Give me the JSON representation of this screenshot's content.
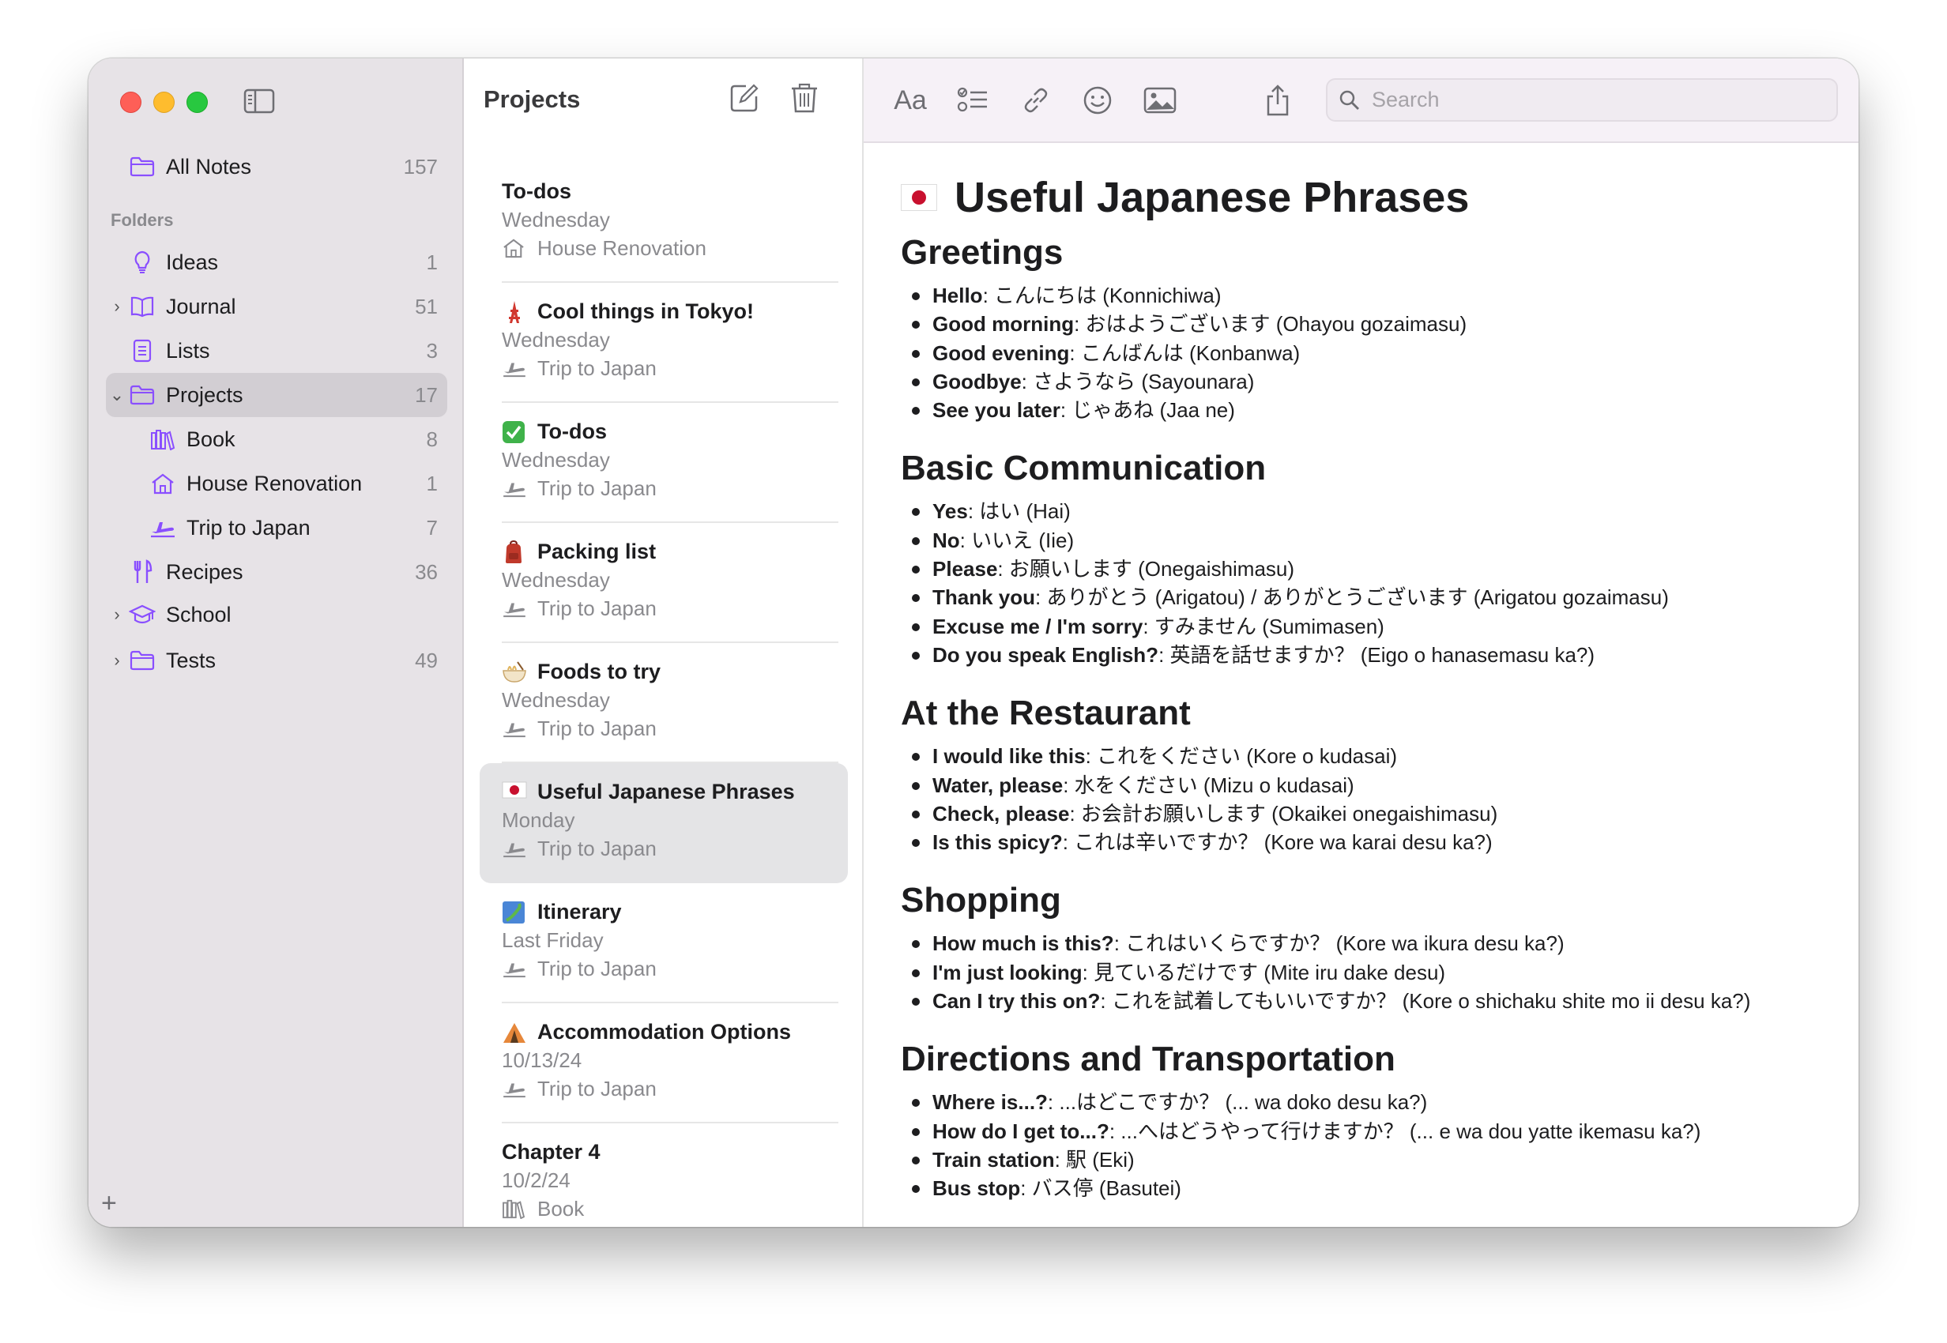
{
  "colors": {
    "accent": "#8a4fff",
    "sidebar_bg": "#e7e3e7",
    "toolbar_bg": "#f6f1f7",
    "traffic_close": "#fe5f57",
    "traffic_min": "#febc2e",
    "traffic_max": "#28c840"
  },
  "sidebar": {
    "all_notes": {
      "label": "All Notes",
      "count": "157",
      "icon": "folder-icon"
    },
    "section_label": "Folders",
    "folders": [
      {
        "label": "Ideas",
        "count": "1",
        "icon": "lightbulb-icon"
      },
      {
        "label": "Journal",
        "count": "51",
        "icon": "book-icon",
        "collapsed": true
      },
      {
        "label": "Lists",
        "count": "3",
        "icon": "list-icon"
      },
      {
        "label": "Projects",
        "count": "17",
        "icon": "folder-icon",
        "expanded": true,
        "selected": true
      },
      {
        "label": "Book",
        "count": "8",
        "icon": "books-icon"
      },
      {
        "label": "House Renovation",
        "count": "1",
        "icon": "house-icon"
      },
      {
        "label": "Trip to Japan",
        "count": "7",
        "icon": "airplane-icon"
      },
      {
        "label": "Recipes",
        "count": "36",
        "icon": "fork-knife-icon"
      },
      {
        "label": "School",
        "count": "",
        "icon": "graduation-cap-icon",
        "collapsed": true
      },
      {
        "label": "Tests",
        "count": "49",
        "icon": "folder-icon",
        "collapsed": true
      }
    ],
    "add_label": "+"
  },
  "note_list": {
    "title": "Projects",
    "notes": [
      {
        "title": "To-dos",
        "date": "Wednesday",
        "folder": "House Renovation",
        "emoji": "",
        "folder_icon": "house-icon"
      },
      {
        "title": "Cool things in Tokyo!",
        "date": "Wednesday",
        "folder": "Trip to Japan",
        "emoji": "tokyo-tower",
        "folder_icon": "airplane-icon"
      },
      {
        "title": "To-dos",
        "date": "Wednesday",
        "folder": "Trip to Japan",
        "emoji": "check-mark-button",
        "folder_icon": "airplane-icon"
      },
      {
        "title": "Packing list",
        "date": "Wednesday",
        "folder": "Trip to Japan",
        "emoji": "backpack",
        "folder_icon": "airplane-icon"
      },
      {
        "title": "Foods to try",
        "date": "Wednesday",
        "folder": "Trip to Japan",
        "emoji": "ramen-bowl",
        "folder_icon": "airplane-icon"
      },
      {
        "title": "Useful Japanese Phrases",
        "date": "Monday",
        "folder": "Trip to Japan",
        "emoji": "japan-flag",
        "folder_icon": "airplane-icon",
        "selected": true
      },
      {
        "title": "Itinerary",
        "date": "Last Friday",
        "folder": "Trip to Japan",
        "emoji": "japan-map",
        "folder_icon": "airplane-icon"
      },
      {
        "title": "Accommodation Options",
        "date": "10/13/24",
        "folder": "Trip to Japan",
        "emoji": "tent",
        "folder_icon": "airplane-icon"
      },
      {
        "title": "Chapter 4",
        "date": "10/2/24",
        "folder": "Book",
        "emoji": "",
        "folder_icon": "books-icon"
      }
    ]
  },
  "toolbar": {
    "format_label": "Aa",
    "search_placeholder": "Search"
  },
  "document": {
    "title": "Useful Japanese Phrases",
    "sections": [
      {
        "heading": "Greetings",
        "items": [
          {
            "term": "Hello",
            "text": ": こんにちは (Konnichiwa)"
          },
          {
            "term": "Good morning",
            "text": ": おはようございます (Ohayou gozaimasu)"
          },
          {
            "term": "Good evening",
            "text": ": こんばんは (Konbanwa)"
          },
          {
            "term": "Goodbye",
            "text": ": さようなら (Sayounara)"
          },
          {
            "term": "See you later",
            "text": ": じゃあね (Jaa ne)"
          }
        ]
      },
      {
        "heading": "Basic Communication",
        "items": [
          {
            "term": "Yes",
            "text": ": はい (Hai)"
          },
          {
            "term": "No",
            "text": ": いいえ (Iie)"
          },
          {
            "term": "Please",
            "text": ": お願いします (Onegaishimasu)"
          },
          {
            "term": "Thank you",
            "text": ": ありがとう (Arigatou) / ありがとうございます (Arigatou gozaimasu)"
          },
          {
            "term": "Excuse me / I'm sorry",
            "text": ": すみません (Sumimasen)"
          },
          {
            "term": "Do you speak English?",
            "text": ": 英語を話せますか？ (Eigo o hanasemasu ka?)"
          }
        ]
      },
      {
        "heading": "At the Restaurant",
        "items": [
          {
            "term": "I would like this",
            "text": ": これをください (Kore o kudasai)"
          },
          {
            "term": "Water, please",
            "text": ": 水をください (Mizu o kudasai)"
          },
          {
            "term": "Check, please",
            "text": ": お会計お願いします (Okaikei onegaishimasu)"
          },
          {
            "term": "Is this spicy?",
            "text": ": これは辛いですか？ (Kore wa karai desu ka?)"
          }
        ]
      },
      {
        "heading": "Shopping",
        "items": [
          {
            "term": "How much is this?",
            "text": ": これはいくらですか？ (Kore wa ikura desu ka?)"
          },
          {
            "term": "I'm just looking",
            "text": ": 見ているだけです (Mite iru dake desu)"
          },
          {
            "term": "Can I try this on?",
            "text": ": これを試着してもいいですか？ (Kore o shichaku shite mo ii desu ka?)"
          }
        ]
      },
      {
        "heading": "Directions and Transportation",
        "items": [
          {
            "term": "Where is...?",
            "text": ": ...はどこですか？ (... wa doko desu ka?)"
          },
          {
            "term": "How do I get to...?",
            "text": ": ...へはどうやって行けますか？ (... e wa dou yatte ikemasu ka?)"
          },
          {
            "term": "Train station",
            "text": ": 駅 (Eki)"
          },
          {
            "term": "Bus stop",
            "text": ": バス停 (Basutei)"
          }
        ]
      }
    ]
  }
}
